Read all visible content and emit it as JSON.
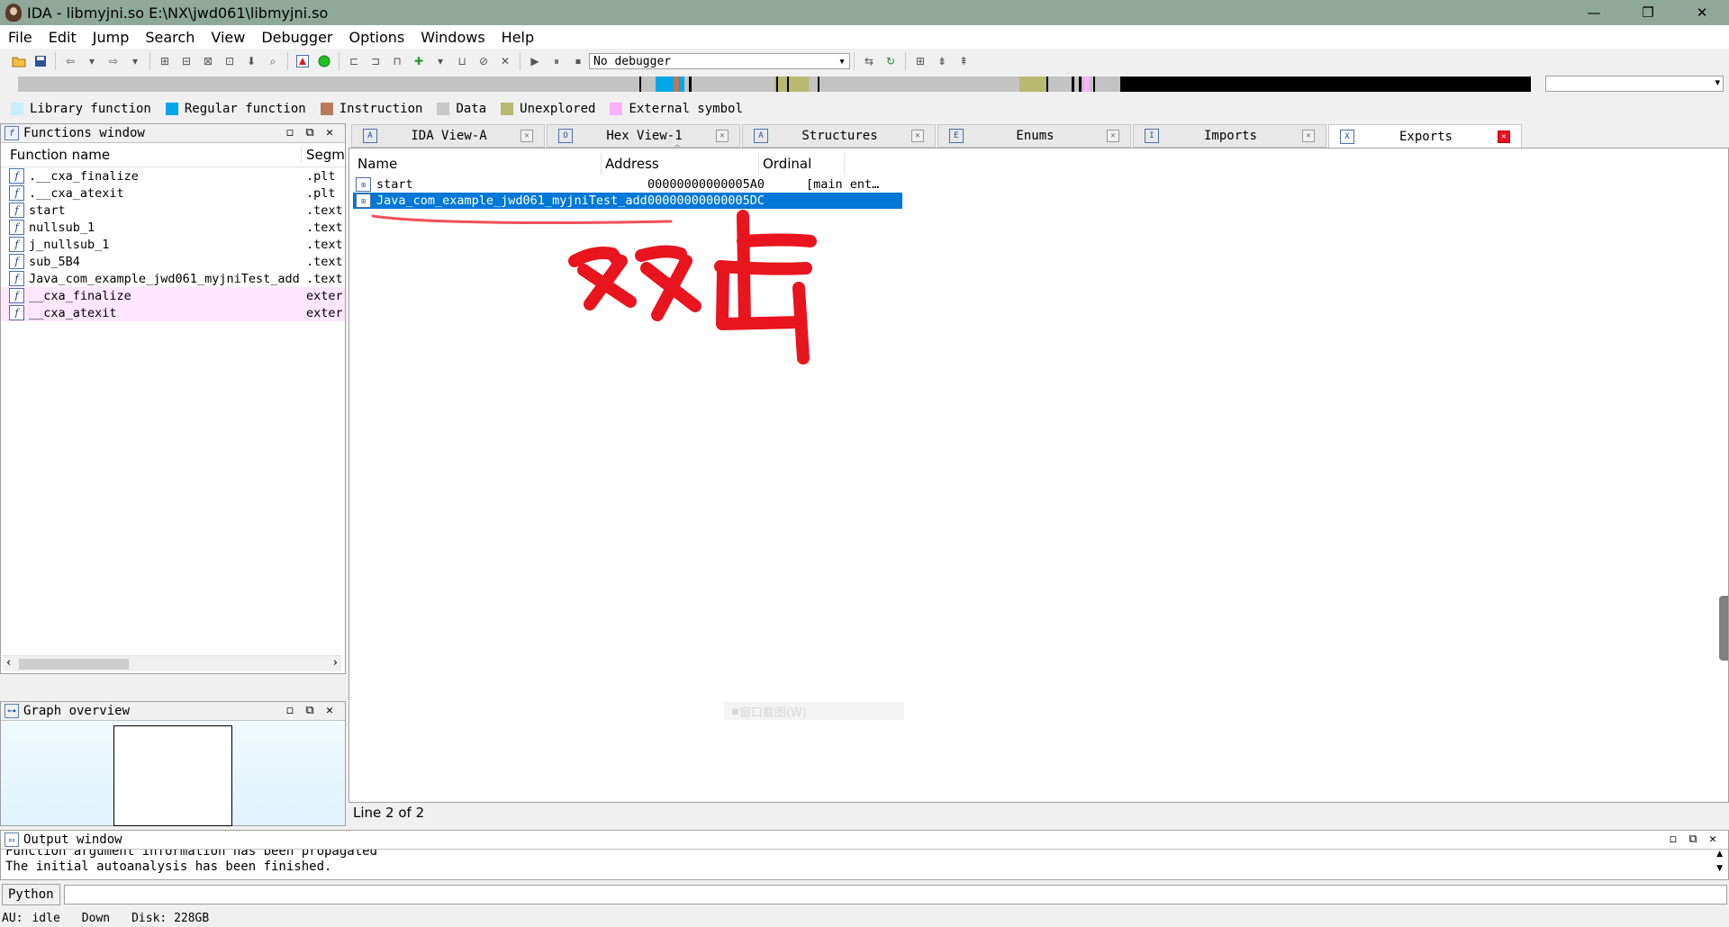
{
  "window": {
    "title": "IDA - libmyjni.so E:\\NX\\jwd061\\libmyjni.so",
    "min": "—",
    "max": "❐",
    "close": "✕"
  },
  "menu": [
    "File",
    "Edit",
    "Jump",
    "Search",
    "View",
    "Debugger",
    "Options",
    "Windows",
    "Help"
  ],
  "toolbar": {
    "debugger": "No debugger"
  },
  "legend": [
    {
      "label": "Library function",
      "color": "#c8f0ff"
    },
    {
      "label": "Regular function",
      "color": "#00a8e8"
    },
    {
      "label": "Instruction",
      "color": "#b87a5a"
    },
    {
      "label": "Data",
      "color": "#c8c8c8"
    },
    {
      "label": "Unexplored",
      "color": "#b8b870"
    },
    {
      "label": "External symbol",
      "color": "#ffb0ff"
    }
  ],
  "functions_window": {
    "title": "Functions window",
    "col_name": "Function name",
    "col_seg": "Segm",
    "rows": [
      {
        "name": ".__cxa_finalize",
        "seg": ".plt",
        "ext": false
      },
      {
        "name": ".__cxa_atexit",
        "seg": ".plt",
        "ext": false
      },
      {
        "name": "start",
        "seg": ".text",
        "ext": false
      },
      {
        "name": "nullsub_1",
        "seg": ".text",
        "ext": false
      },
      {
        "name": "j_nullsub_1",
        "seg": ".text",
        "ext": false
      },
      {
        "name": "sub_5B4",
        "seg": ".text",
        "ext": false
      },
      {
        "name": "Java_com_example_jwd061_myjniTest_add",
        "seg": ".text",
        "ext": false
      },
      {
        "name": "__cxa_finalize",
        "seg": "extern",
        "ext": true
      },
      {
        "name": "__cxa_atexit",
        "seg": "extern",
        "ext": true
      }
    ]
  },
  "graph_overview": {
    "title": "Graph overview"
  },
  "tabs": [
    {
      "label": "IDA View-A",
      "icon": "A"
    },
    {
      "label": "Hex View-1",
      "icon": "O"
    },
    {
      "label": "Structures",
      "icon": "A"
    },
    {
      "label": "Enums",
      "icon": "E"
    },
    {
      "label": "Imports",
      "icon": "I"
    },
    {
      "label": "Exports",
      "icon": "X"
    }
  ],
  "exports": {
    "col_name": "Name",
    "col_address": "Address",
    "col_ordinal": "Ordinal",
    "rows": [
      {
        "name": "start",
        "address": "00000000000005A0",
        "ordinal": "[main ent…"
      },
      {
        "name": "Java_com_example_jwd061_myjniTest_add",
        "address": "00000000000005DC",
        "ordinal": ""
      }
    ],
    "status": "Line 2 of 2",
    "ghost_menu": "窗口截图(W)"
  },
  "annotation": {
    "text": "双击",
    "color": "#e8141e"
  },
  "output_window": {
    "title": "Output window",
    "lines": [
      "Function argument information has been propagated",
      "The initial autoanalysis has been finished."
    ]
  },
  "python": {
    "label": "Python"
  },
  "statusbar": {
    "au": "AU:",
    "state": "idle",
    "dir": "Down",
    "disk": "Disk: 228GB"
  }
}
